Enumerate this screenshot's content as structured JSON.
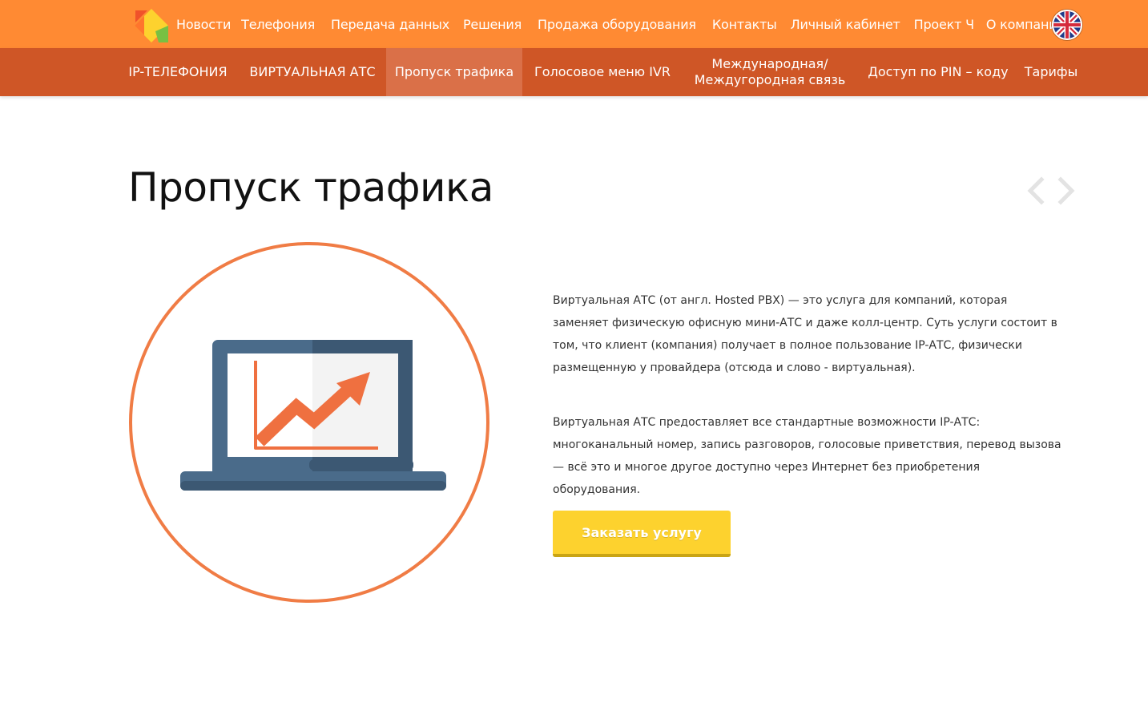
{
  "topnav": {
    "items": [
      {
        "label": "Новости"
      },
      {
        "label": "Телефония"
      },
      {
        "label": "Передача данных"
      },
      {
        "label": "Решения"
      },
      {
        "label": "Продажа оборудования"
      },
      {
        "label": "Контакты"
      },
      {
        "label": "Личный кабинет"
      },
      {
        "label": "Проект Ч"
      },
      {
        "label": "О компании"
      }
    ],
    "language_icon": "uk-flag-icon"
  },
  "subnav": {
    "items": [
      {
        "label": "IP-ТЕЛЕФОНИЯ"
      },
      {
        "label": "ВИРТУАЛЬНАЯ АТС"
      },
      {
        "label": "Пропуск трафика",
        "active": true
      },
      {
        "label": "Голосовое меню IVR"
      },
      {
        "label_line1": "Международная/",
        "label_line2": "Междугородная связь"
      },
      {
        "label": "Доступ по PIN – коду"
      },
      {
        "label": "Тарифы"
      }
    ]
  },
  "main": {
    "title": "Пропуск трафика",
    "paragraphs": [
      "Виртуальная АТС (от англ. Hosted PBX) — это услуга для компаний, которая заменяет физическую офисную мини-АТС и даже колл-центр. Суть услуги состоит в том, что клиент (компания) получает в полное пользование IP-АТС, физически размещенную у провайдера (отсюда и слово - виртуальная).",
      "Виртуальная АТС предоставляет все стандартные возможности IP-АТС: многоканальный номер, запись разговоров, голосовые приветствия, перевод вызова — всё это и многое другое доступно через Интернет без приобретения оборудования."
    ],
    "cta_label": "Заказать услугу",
    "illustration_icon": "laptop-growth-chart-icon"
  },
  "colors": {
    "topbar": "#ff8a33",
    "subnav": "#cf5626",
    "subnav_active": "#da7048",
    "accent_circle": "#f07c45",
    "button": "#fdd22e",
    "laptop": "#4a6b8a"
  }
}
